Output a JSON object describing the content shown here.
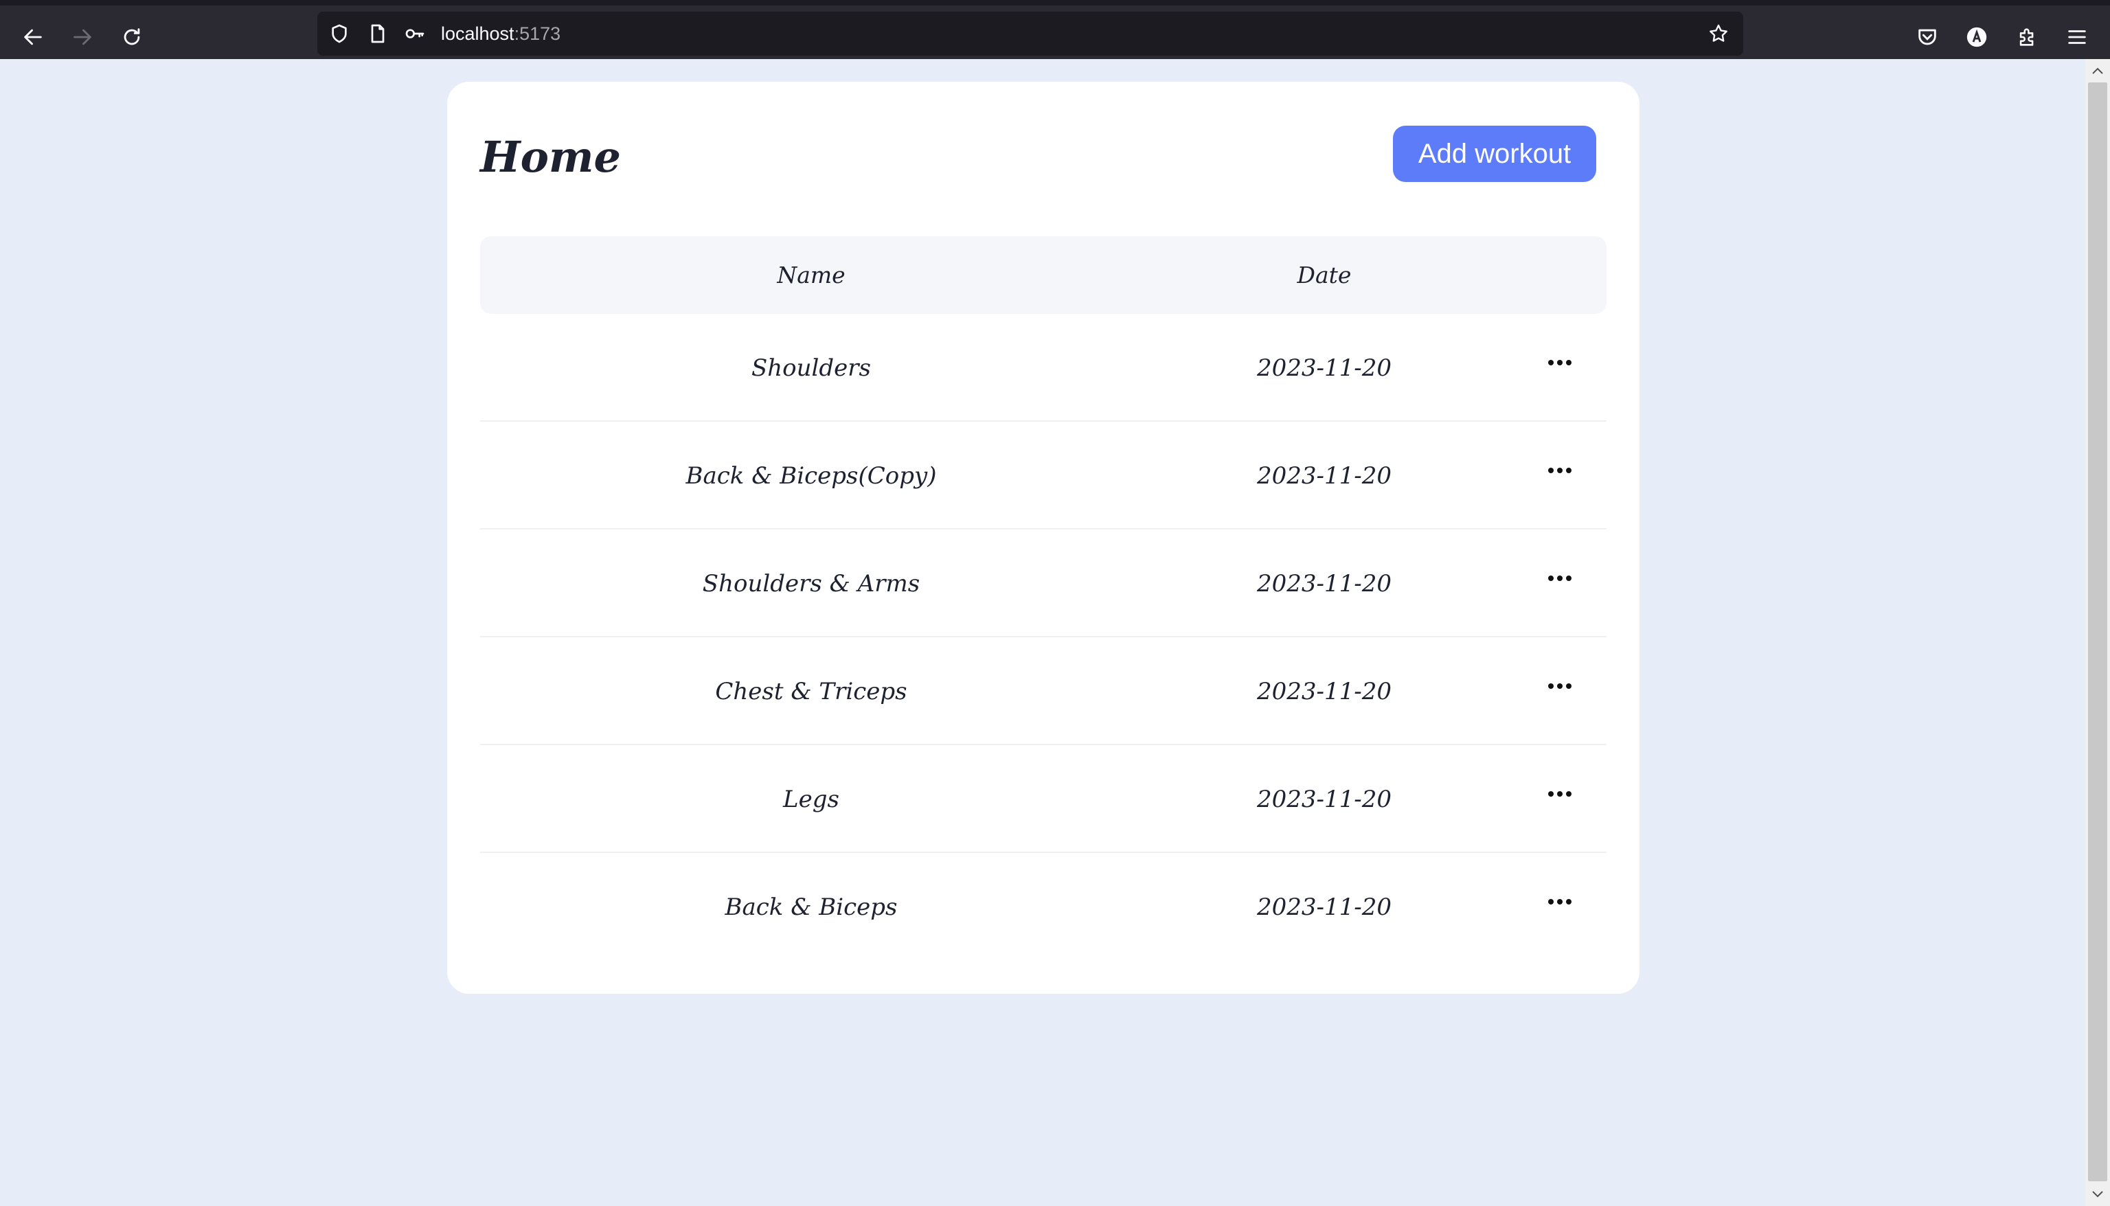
{
  "browser": {
    "url_host": "localhost",
    "url_port": ":5173"
  },
  "page": {
    "title": "Home",
    "add_button": "Add workout"
  },
  "table": {
    "headers": {
      "name": "Name",
      "date": "Date"
    },
    "rows": [
      {
        "name": "Shoulders",
        "date": "2023-11-20"
      },
      {
        "name": "Back & Biceps(Copy)",
        "date": "2023-11-20"
      },
      {
        "name": "Shoulders & Arms",
        "date": "2023-11-20"
      },
      {
        "name": "Chest & Triceps",
        "date": "2023-11-20"
      },
      {
        "name": "Legs",
        "date": "2023-11-20"
      },
      {
        "name": "Back & Biceps",
        "date": "2023-11-20"
      }
    ]
  },
  "icons": {
    "row_action": "more-horizontal-icon"
  }
}
